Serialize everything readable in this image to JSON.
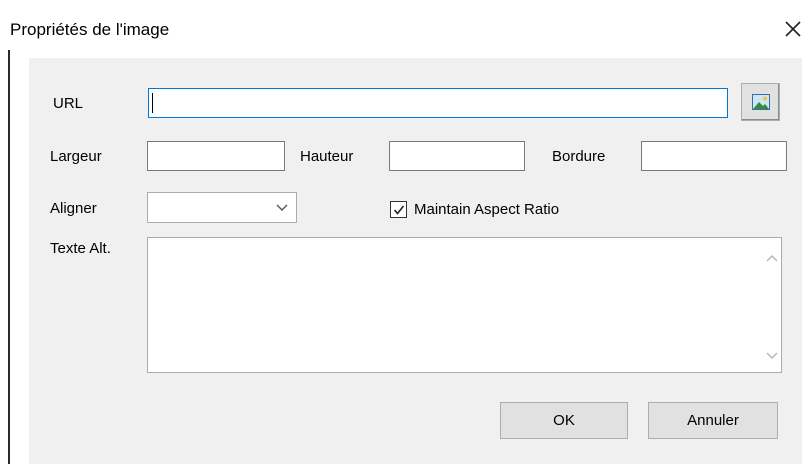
{
  "dialog": {
    "title": "Propriétés de l'image"
  },
  "icons": {
    "close": "close-icon",
    "browse": "image-icon",
    "dropdown": "chevron-down-icon",
    "scroll_up": "chevron-up-icon",
    "scroll_down": "chevron-down-icon",
    "check": "checkmark-icon"
  },
  "form": {
    "url_label": "URL",
    "url_value": "",
    "width_label": "Largeur",
    "width_value": "",
    "height_label": "Hauteur",
    "height_value": "",
    "border_label": "Bordure",
    "border_value": "",
    "align_label": "Aligner",
    "align_value": "",
    "aspect_label": "Maintain Aspect Ratio",
    "aspect_checked": true,
    "alt_label": "Texte Alt.",
    "alt_value": ""
  },
  "buttons": {
    "ok": "OK",
    "cancel": "Annuler"
  }
}
